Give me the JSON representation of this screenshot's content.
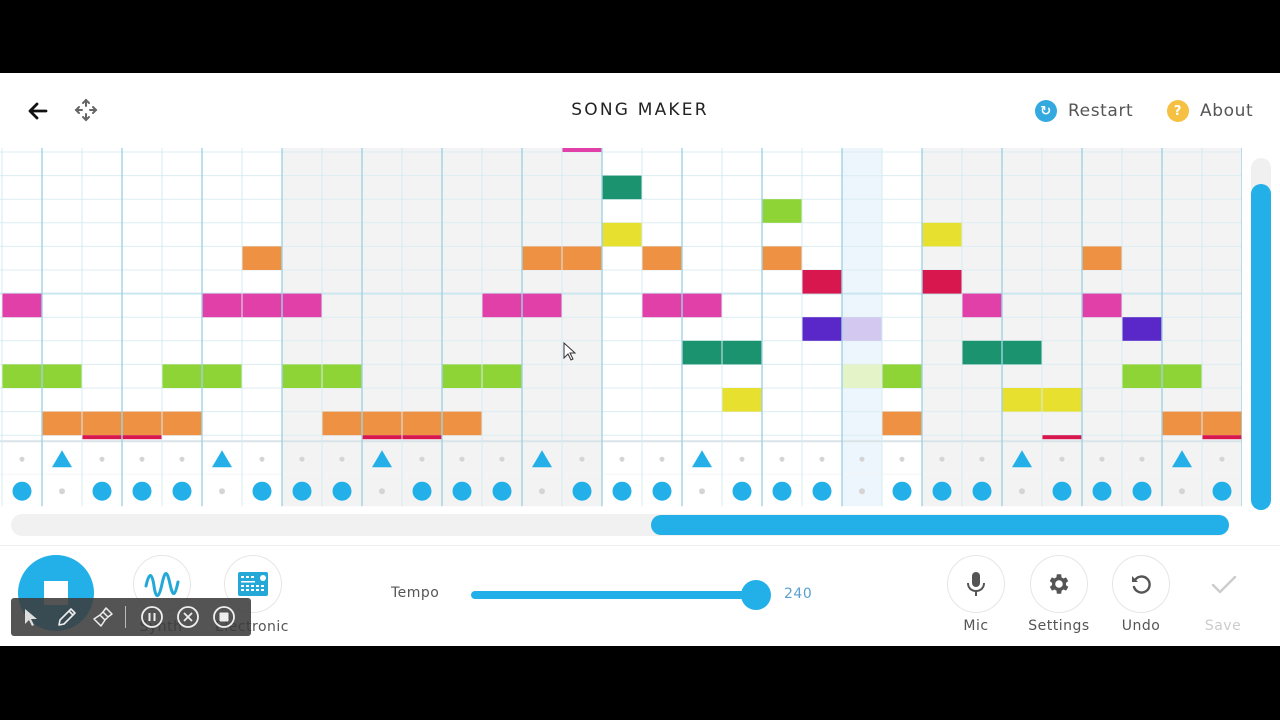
{
  "header": {
    "title": "SONG MAKER",
    "restart_label": "Restart",
    "about_label": "About",
    "restart_color": "#33a9e0",
    "about_color": "#f6c143"
  },
  "grid": {
    "columns": 31,
    "beats_per_bar": 8,
    "highlight_column": 21,
    "shading_bars": [
      "white",
      "gray",
      "white",
      "gray"
    ],
    "melody_notes": [
      {
        "row": -1,
        "col": 14,
        "len": 1,
        "color": "#e040a8"
      },
      {
        "row": 1,
        "col": 15,
        "len": 1,
        "color": "#1b936e"
      },
      {
        "row": 2,
        "col": 19,
        "len": 1,
        "color": "#8fd436"
      },
      {
        "row": 3,
        "col": 15,
        "len": 1,
        "color": "#e8e02e"
      },
      {
        "row": 3,
        "col": 23,
        "len": 1,
        "color": "#e8e02e"
      },
      {
        "row": 4,
        "col": 6,
        "len": 1,
        "color": "#ef9142"
      },
      {
        "row": 4,
        "col": 13,
        "len": 2,
        "color": "#ef9142"
      },
      {
        "row": 4,
        "col": 16,
        "len": 1,
        "color": "#ef9142"
      },
      {
        "row": 4,
        "col": 19,
        "len": 1,
        "color": "#ef9142"
      },
      {
        "row": 4,
        "col": 27,
        "len": 1,
        "color": "#ef9142"
      },
      {
        "row": 5,
        "col": 20,
        "len": 1,
        "color": "#d8174f"
      },
      {
        "row": 5,
        "col": 23,
        "len": 1,
        "color": "#d8174f"
      },
      {
        "row": 6,
        "col": 0,
        "len": 1,
        "color": "#e040a8"
      },
      {
        "row": 6,
        "col": 5,
        "len": 3,
        "color": "#e040a8"
      },
      {
        "row": 6,
        "col": 12,
        "len": 2,
        "color": "#e040a8"
      },
      {
        "row": 6,
        "col": 16,
        "len": 2,
        "color": "#e040a8"
      },
      {
        "row": 6,
        "col": 24,
        "len": 1,
        "color": "#e040a8"
      },
      {
        "row": 6,
        "col": 27,
        "len": 1,
        "color": "#e040a8"
      },
      {
        "row": 7,
        "col": 20,
        "len": 1,
        "color": "#5a28c8"
      },
      {
        "row": 7,
        "col": 21,
        "len": 1,
        "color": "#d2c8f0"
      },
      {
        "row": 7,
        "col": 28,
        "len": 1,
        "color": "#5a28c8"
      },
      {
        "row": 8,
        "col": 17,
        "len": 2,
        "color": "#1b936e"
      },
      {
        "row": 8,
        "col": 24,
        "len": 2,
        "color": "#1b936e"
      },
      {
        "row": 9,
        "col": 0,
        "len": 2,
        "color": "#8fd436"
      },
      {
        "row": 9,
        "col": 4,
        "len": 2,
        "color": "#8fd436"
      },
      {
        "row": 9,
        "col": 7,
        "len": 2,
        "color": "#8fd436"
      },
      {
        "row": 9,
        "col": 11,
        "len": 2,
        "color": "#8fd436"
      },
      {
        "row": 9,
        "col": 21,
        "len": 1,
        "color": "#e4f4c8"
      },
      {
        "row": 9,
        "col": 22,
        "len": 1,
        "color": "#8fd436"
      },
      {
        "row": 9,
        "col": 28,
        "len": 2,
        "color": "#8fd436"
      },
      {
        "row": 10,
        "col": 18,
        "len": 1,
        "color": "#e8e02e"
      },
      {
        "row": 10,
        "col": 25,
        "len": 2,
        "color": "#e8e02e"
      },
      {
        "row": 11,
        "col": 1,
        "len": 4,
        "color": "#ef9142"
      },
      {
        "row": 11,
        "col": 8,
        "len": 4,
        "color": "#ef9142"
      },
      {
        "row": 11,
        "col": 22,
        "len": 1,
        "color": "#ef9142"
      },
      {
        "row": 11,
        "col": 29,
        "len": 2,
        "color": "#ef9142"
      },
      {
        "row": 12,
        "col": 2,
        "len": 2,
        "color": "#d8174f"
      },
      {
        "row": 12,
        "col": 9,
        "len": 2,
        "color": "#d8174f"
      },
      {
        "row": 12,
        "col": 26,
        "len": 1,
        "color": "#d8174f"
      },
      {
        "row": 12,
        "col": 30,
        "len": 1,
        "color": "#d8174f"
      }
    ],
    "percussion": {
      "triangle_columns": [
        1,
        5,
        9,
        13,
        17,
        25,
        29
      ],
      "circle_columns": [
        0,
        2,
        3,
        4,
        6,
        7,
        8,
        10,
        11,
        12,
        14,
        15,
        16,
        18,
        19,
        20,
        22,
        23,
        24,
        26,
        27,
        28,
        30
      ],
      "color": "#23b0e8"
    }
  },
  "scroll": {
    "horizontal_position_fraction": 0.53,
    "vertical_position_fraction": 0.08
  },
  "controls": {
    "instrument_label": "Synth",
    "percussion_label": "Electronic",
    "tempo_label": "Tempo",
    "tempo_value": "240",
    "tempo_fraction": 0.95,
    "mic_label": "Mic",
    "settings_label": "Settings",
    "undo_label": "Undo",
    "save_label": "Save"
  },
  "overlay_toolbar": {
    "tools": [
      "cursor",
      "pen",
      "brush",
      "pause",
      "close",
      "stop"
    ]
  }
}
